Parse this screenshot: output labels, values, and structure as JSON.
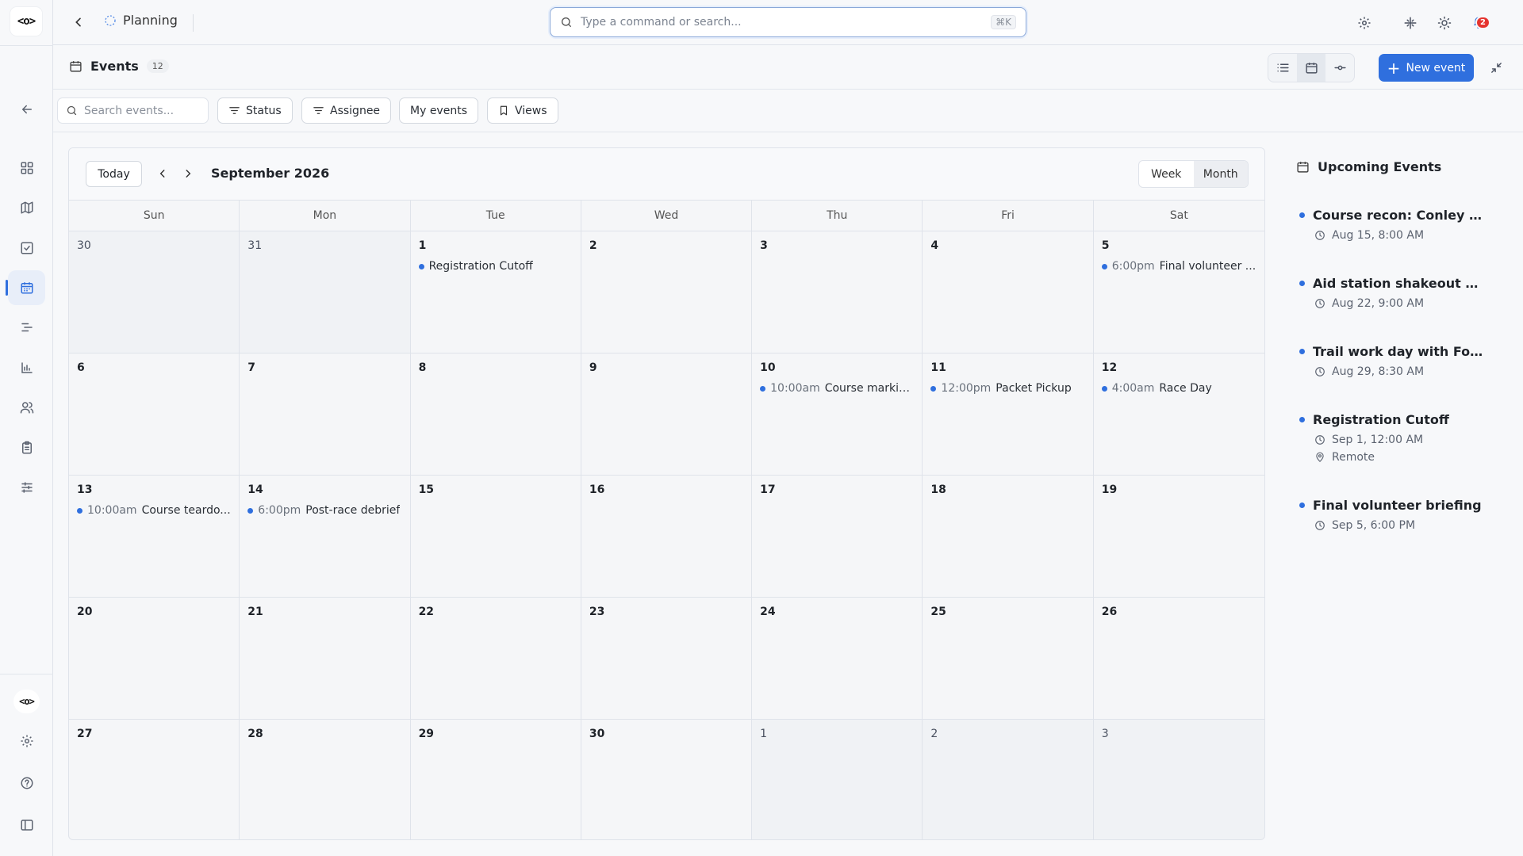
{
  "topbar": {
    "breadcrumb": "Planning",
    "command_placeholder": "Type a command or search...",
    "shortcut": "⌘K",
    "notification_count": "2"
  },
  "page": {
    "title": "Events",
    "count": "12",
    "new_event_label": "New event"
  },
  "filters": {
    "search_placeholder": "Search events...",
    "status": "Status",
    "assignee": "Assignee",
    "my_events": "My events",
    "views": "Views"
  },
  "calendar": {
    "today_label": "Today",
    "month_title": "September 2026",
    "week_label": "Week",
    "month_label": "Month",
    "days_of_week": [
      "Sun",
      "Mon",
      "Tue",
      "Wed",
      "Thu",
      "Fri",
      "Sat"
    ],
    "cells": [
      {
        "d": "30",
        "outside": true,
        "events": []
      },
      {
        "d": "31",
        "outside": true,
        "events": []
      },
      {
        "d": "1",
        "outside": false,
        "events": [
          {
            "time": "",
            "name": "Registration Cutoff"
          }
        ]
      },
      {
        "d": "2",
        "outside": false,
        "events": []
      },
      {
        "d": "3",
        "outside": false,
        "events": []
      },
      {
        "d": "4",
        "outside": false,
        "events": []
      },
      {
        "d": "5",
        "outside": false,
        "events": [
          {
            "time": "6:00pm",
            "name": "Final volunteer ..."
          }
        ]
      },
      {
        "d": "6",
        "outside": false,
        "events": []
      },
      {
        "d": "7",
        "outside": false,
        "events": []
      },
      {
        "d": "8",
        "outside": false,
        "events": []
      },
      {
        "d": "9",
        "outside": false,
        "events": []
      },
      {
        "d": "10",
        "outside": false,
        "events": [
          {
            "time": "10:00am",
            "name": "Course markin..."
          }
        ]
      },
      {
        "d": "11",
        "outside": false,
        "events": [
          {
            "time": "12:00pm",
            "name": "Packet Pickup"
          }
        ]
      },
      {
        "d": "12",
        "outside": false,
        "events": [
          {
            "time": "4:00am",
            "name": "Race Day"
          }
        ]
      },
      {
        "d": "13",
        "outside": false,
        "events": [
          {
            "time": "10:00am",
            "name": "Course teardo..."
          }
        ]
      },
      {
        "d": "14",
        "outside": false,
        "events": [
          {
            "time": "6:00pm",
            "name": "Post-race debrief"
          }
        ]
      },
      {
        "d": "15",
        "outside": false,
        "events": []
      },
      {
        "d": "16",
        "outside": false,
        "events": []
      },
      {
        "d": "17",
        "outside": false,
        "events": []
      },
      {
        "d": "18",
        "outside": false,
        "events": []
      },
      {
        "d": "19",
        "outside": false,
        "events": []
      },
      {
        "d": "20",
        "outside": false,
        "events": []
      },
      {
        "d": "21",
        "outside": false,
        "events": []
      },
      {
        "d": "22",
        "outside": false,
        "events": []
      },
      {
        "d": "23",
        "outside": false,
        "events": []
      },
      {
        "d": "24",
        "outside": false,
        "events": []
      },
      {
        "d": "25",
        "outside": false,
        "events": []
      },
      {
        "d": "26",
        "outside": false,
        "events": []
      },
      {
        "d": "27",
        "outside": false,
        "events": []
      },
      {
        "d": "28",
        "outside": false,
        "events": []
      },
      {
        "d": "29",
        "outside": false,
        "events": []
      },
      {
        "d": "30",
        "outside": false,
        "events": []
      },
      {
        "d": "1",
        "outside": true,
        "events": []
      },
      {
        "d": "2",
        "outside": true,
        "events": []
      },
      {
        "d": "3",
        "outside": true,
        "events": []
      }
    ]
  },
  "upcoming": {
    "title": "Upcoming Events",
    "items": [
      {
        "name": "Course recon: Conley Cov...",
        "when": "Aug 15, 8:00 AM",
        "where": ""
      },
      {
        "name": "Aid station shakeout & ge...",
        "when": "Aug 22, 9:00 AM",
        "where": ""
      },
      {
        "name": "Trail work day with Forest ...",
        "when": "Aug 29, 8:30 AM",
        "where": ""
      },
      {
        "name": "Registration Cutoff",
        "when": "Sep 1, 12:00 AM",
        "where": "Remote"
      },
      {
        "name": "Final volunteer briefing",
        "when": "Sep 5, 6:00 PM",
        "where": ""
      }
    ]
  },
  "colors": {
    "accent": "#2f6fde",
    "badge": "#e5342f"
  }
}
